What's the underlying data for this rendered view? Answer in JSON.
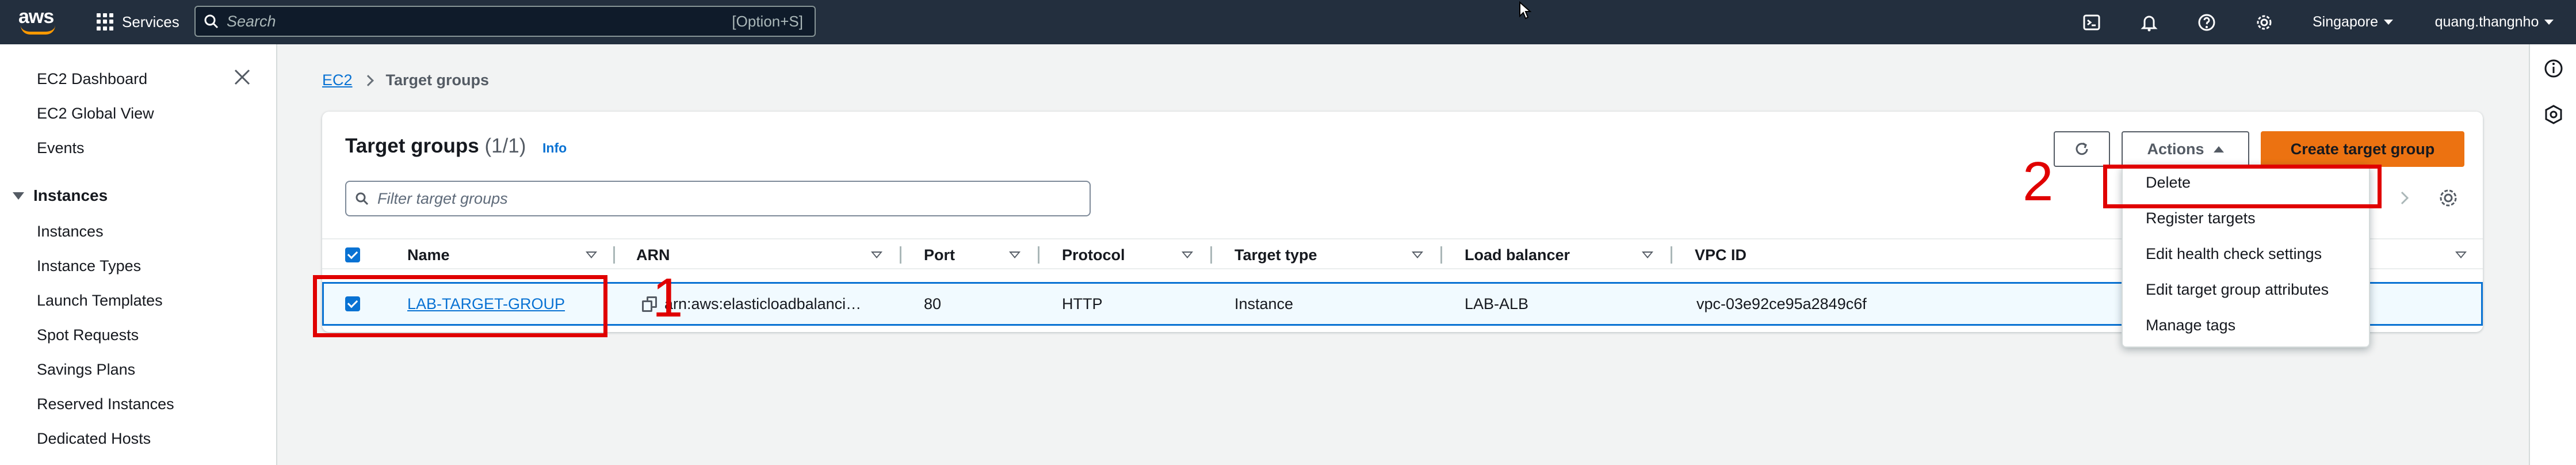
{
  "topnav": {
    "logo": "aws",
    "services_label": "Services",
    "search_placeholder": "Search",
    "search_shortcut": "[Option+S]",
    "region": "Singapore",
    "account": "quang.thangnho"
  },
  "sidebar": {
    "items": [
      {
        "label": "EC2 Dashboard"
      },
      {
        "label": "EC2 Global View"
      },
      {
        "label": "Events"
      }
    ],
    "section": "Instances",
    "section_items": [
      {
        "label": "Instances"
      },
      {
        "label": "Instance Types"
      },
      {
        "label": "Launch Templates"
      },
      {
        "label": "Spot Requests"
      },
      {
        "label": "Savings Plans"
      },
      {
        "label": "Reserved Instances"
      },
      {
        "label": "Dedicated Hosts"
      }
    ]
  },
  "breadcrumb": {
    "root": "EC2",
    "current": "Target groups"
  },
  "panel": {
    "title": "Target groups",
    "count": "(1/1)",
    "info": "Info",
    "filter_placeholder": "Filter target groups",
    "actions_label": "Actions",
    "create_label": "Create target group"
  },
  "table": {
    "columns": [
      "Name",
      "ARN",
      "Port",
      "Protocol",
      "Target type",
      "Load balancer",
      "VPC ID"
    ],
    "rows": [
      {
        "name": "LAB-TARGET-GROUP",
        "arn": "arn:aws:elasticloadbalanci…",
        "port": "80",
        "protocol": "HTTP",
        "target_type": "Instance",
        "load_balancer": "LAB-ALB",
        "vpc_id": "vpc-03e92ce95a2849c6f",
        "selected": true
      }
    ]
  },
  "actions_menu": {
    "items": [
      "Delete",
      "Register targets",
      "Edit health check settings",
      "Edit target group attributes",
      "Manage tags"
    ]
  },
  "annotations": {
    "one": "1",
    "two": "2"
  },
  "colors": {
    "accent": "#0972d3",
    "primary_button": "#ec7211",
    "nav_bg": "#232f3e",
    "annotation": "#e00000"
  }
}
